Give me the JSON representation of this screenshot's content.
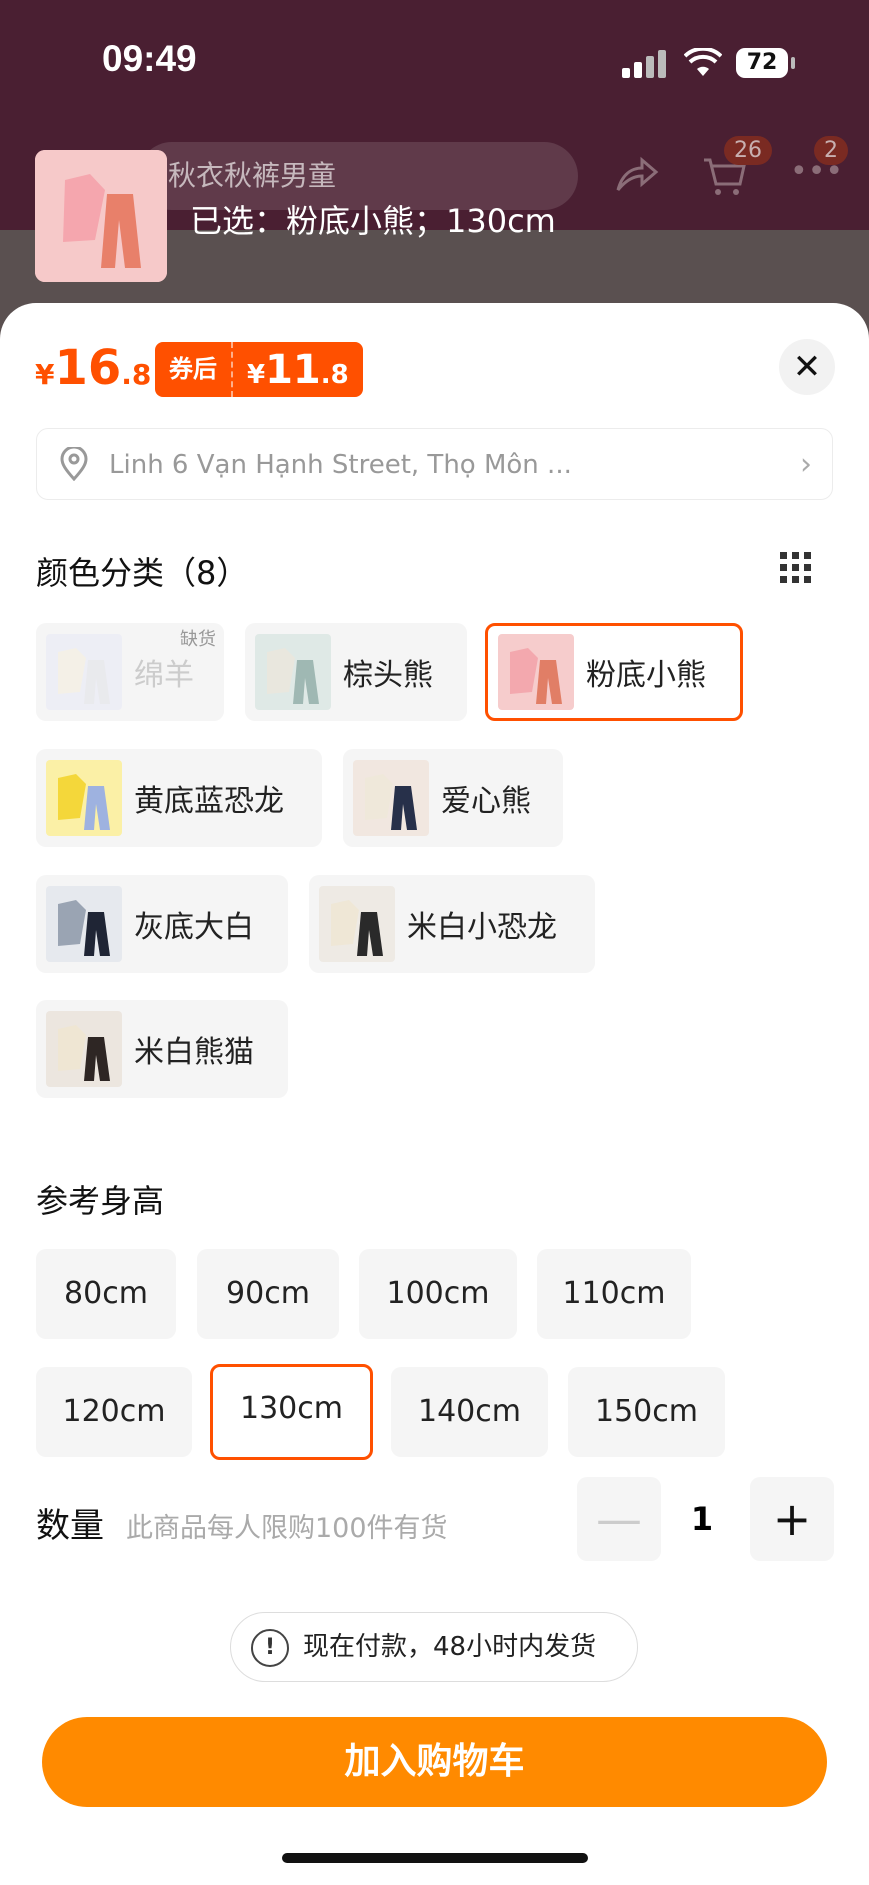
{
  "status": {
    "time": "09:49",
    "battery": "72"
  },
  "background": {
    "search_text": "秋衣秋裤男童",
    "cart_count": "26",
    "more_count": "2"
  },
  "header": {
    "selected_text": "已选：粉底小熊；130cm"
  },
  "price": {
    "currency": "¥",
    "original_int": "16",
    "original_dec": ".8",
    "coupon_tag": "券后",
    "coupon_currency": "¥",
    "coupon_int": "11",
    "coupon_dec": ".8"
  },
  "address": {
    "text": "Linh 6 Vạn Hạnh Street, Thọ Môn ..."
  },
  "colors": {
    "title": "颜色分类（8）",
    "out_of_stock": "缺货",
    "items": [
      {
        "label": "绵羊"
      },
      {
        "label": "棕头熊"
      },
      {
        "label": "粉底小熊"
      },
      {
        "label": "黄底蓝恐龙"
      },
      {
        "label": "爱心熊"
      },
      {
        "label": "灰底大白"
      },
      {
        "label": "米白小恐龙"
      },
      {
        "label": "米白熊猫"
      }
    ]
  },
  "sizes": {
    "title": "参考身高",
    "items": [
      {
        "label": "80cm"
      },
      {
        "label": "90cm"
      },
      {
        "label": "100cm"
      },
      {
        "label": "110cm"
      },
      {
        "label": "120cm"
      },
      {
        "label": "130cm"
      },
      {
        "label": "140cm"
      },
      {
        "label": "150cm"
      }
    ]
  },
  "quantity": {
    "label": "数量",
    "note": "此商品每人限购100件有货",
    "value": "1"
  },
  "notice": {
    "text": "现在付款，48小时内发货"
  },
  "cta": {
    "label": "加入购物车"
  },
  "accent_color": "#ff5000",
  "cta_color": "#ff8a00"
}
